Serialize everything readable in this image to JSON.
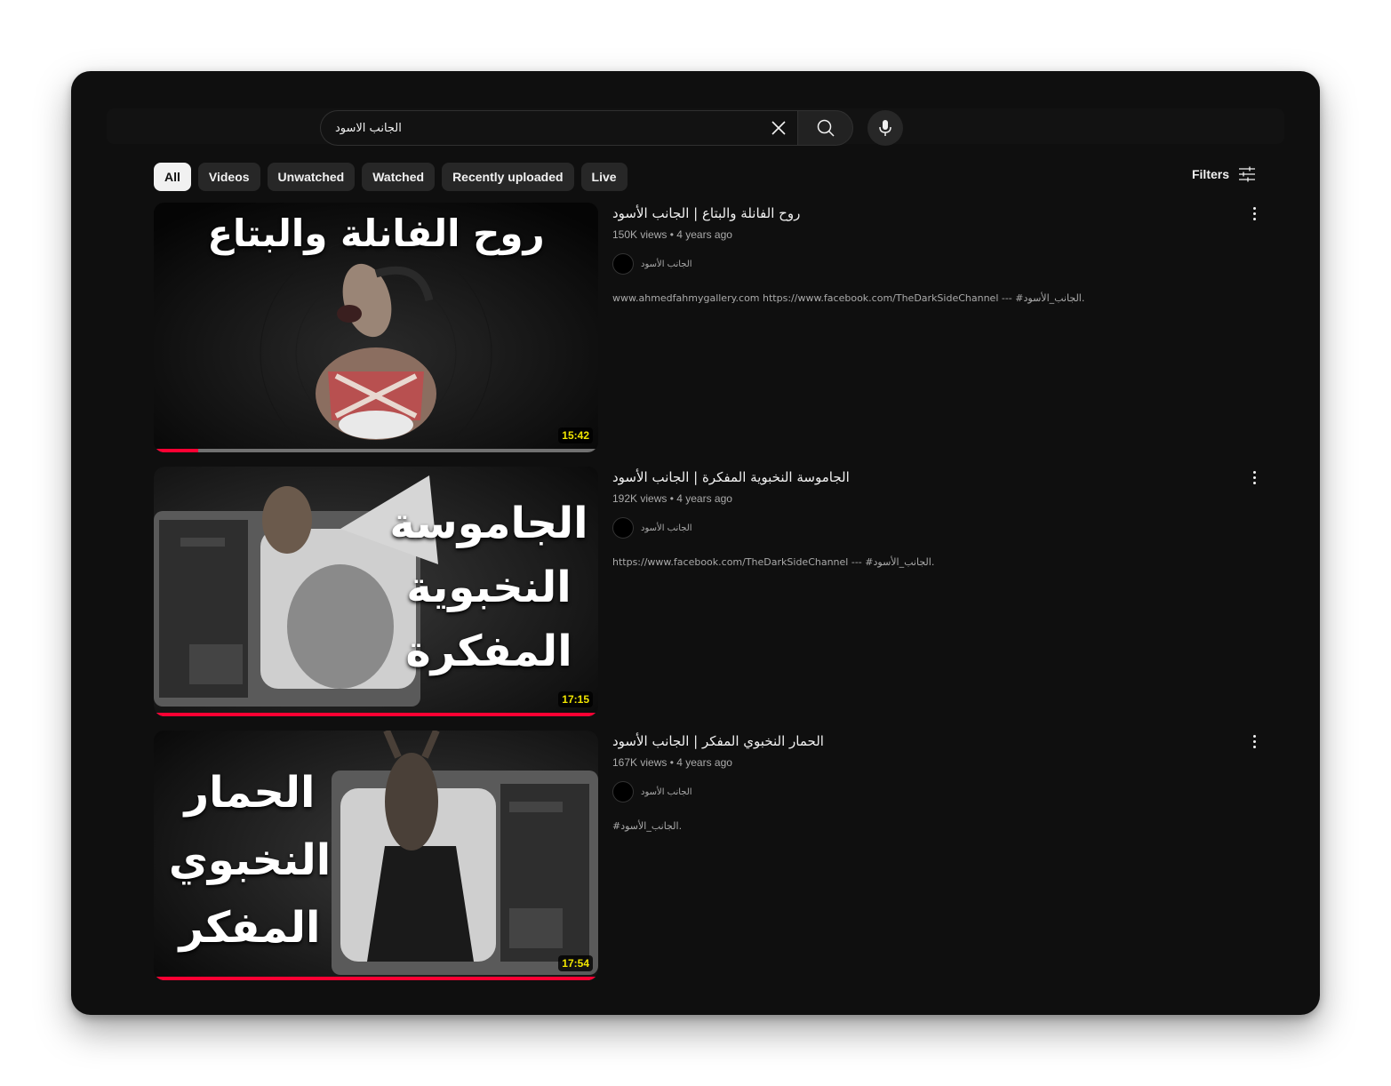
{
  "search": {
    "query": "الجانب الاسود"
  },
  "chips": [
    "All",
    "Videos",
    "Unwatched",
    "Watched",
    "Recently uploaded",
    "Live"
  ],
  "filters_label": "Filters",
  "videos": [
    {
      "thumb_text": "روح الفانلة والبتاع",
      "duration": "15:42",
      "progress": 0.1,
      "title": "روح الفانلة والبتاع | الجانب الأسود",
      "stats": "150K views • 4 years ago",
      "channel": "الجانب الأسود",
      "description": "www.ahmedfahmygallery.com https://www.facebook.com/TheDarkSideChannel --- #الجانب_الأسود."
    },
    {
      "thumb_text": "الجاموسة النخبوية المفكرة",
      "duration": "17:15",
      "progress": 1.0,
      "title": "الجاموسة النخبوية المفكرة | الجانب الأسود",
      "stats": "192K views • 4 years ago",
      "channel": "الجانب الأسود",
      "description": "https://www.facebook.com/TheDarkSideChannel --- #الجانب_الأسود."
    },
    {
      "thumb_text": "الحمار النخبوي المفكر",
      "duration": "17:54",
      "progress": 1.0,
      "title": "الحمار النخبوي المفكر | الجانب الأسود",
      "stats": "167K views • 4 years ago",
      "channel": "الجانب الأسود",
      "description": "#الجانب_الأسود."
    }
  ],
  "colors": {
    "background": "#0f0f0f",
    "chip": "#272727",
    "chip_active": "#f1f1f1",
    "progress": "#ff0033",
    "duration_text": "#f2e600"
  },
  "icons": [
    "clear-icon",
    "search-icon",
    "mic-icon",
    "filters-icon",
    "more-vert-icon"
  ]
}
